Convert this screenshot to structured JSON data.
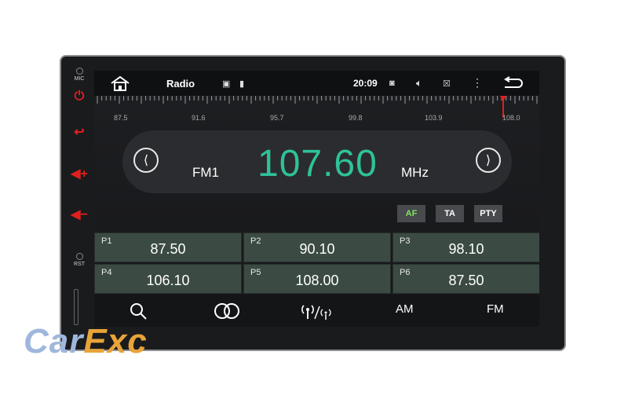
{
  "side_panel": {
    "mic_label": "MIC",
    "rst_label": "RST"
  },
  "status": {
    "title": "Radio",
    "time": "20:09"
  },
  "scale_labels": [
    "87.5",
    "91.6",
    "95.7",
    "99.8",
    "103.9",
    "108.0"
  ],
  "tuner": {
    "band": "FM1",
    "frequency": "107.60",
    "unit": "MHz"
  },
  "rds_buttons": [
    "AF",
    "TA",
    "PTY"
  ],
  "presets": [
    {
      "num": "P1",
      "value": "87.50"
    },
    {
      "num": "P2",
      "value": "90.10"
    },
    {
      "num": "P3",
      "value": "98.10"
    },
    {
      "num": "P4",
      "value": "106.10"
    },
    {
      "num": "P5",
      "value": "108.00"
    },
    {
      "num": "P6",
      "value": "87.50"
    }
  ],
  "bottom_bar": {
    "am_label": "AM",
    "fm_label": "FM"
  },
  "watermark": {
    "part1": "Car",
    "part2": "Exc"
  },
  "colors": {
    "accent": "#2ec29a",
    "af_active": "#7ee35f",
    "hardware_red": "#e0201f"
  }
}
